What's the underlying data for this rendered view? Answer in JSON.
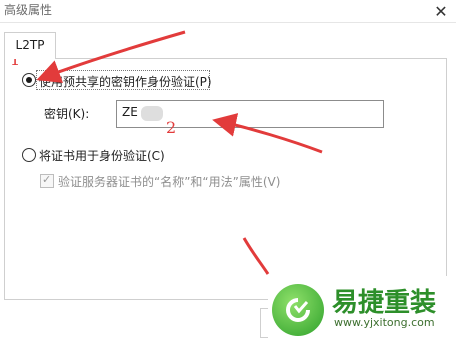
{
  "window": {
    "title": "高级属性",
    "close_glyph": "✕"
  },
  "tabs": [
    {
      "label": "L2TP"
    }
  ],
  "auth": {
    "psk_option_label": "使用预共享的密钥作身份验证(P)",
    "key_label": "密钥(K):",
    "key_value": "ZE",
    "cert_option_label": "将证书用于身份验证(C)",
    "verify_checkbox_label": "验证服务器证书的“名称”和“用法”属性(V)"
  },
  "annotations": {
    "step1": "1",
    "step2": "2",
    "color": "#e23b3b"
  },
  "watermark": {
    "title": "易捷重装",
    "url": "www.yjxitong.com"
  }
}
